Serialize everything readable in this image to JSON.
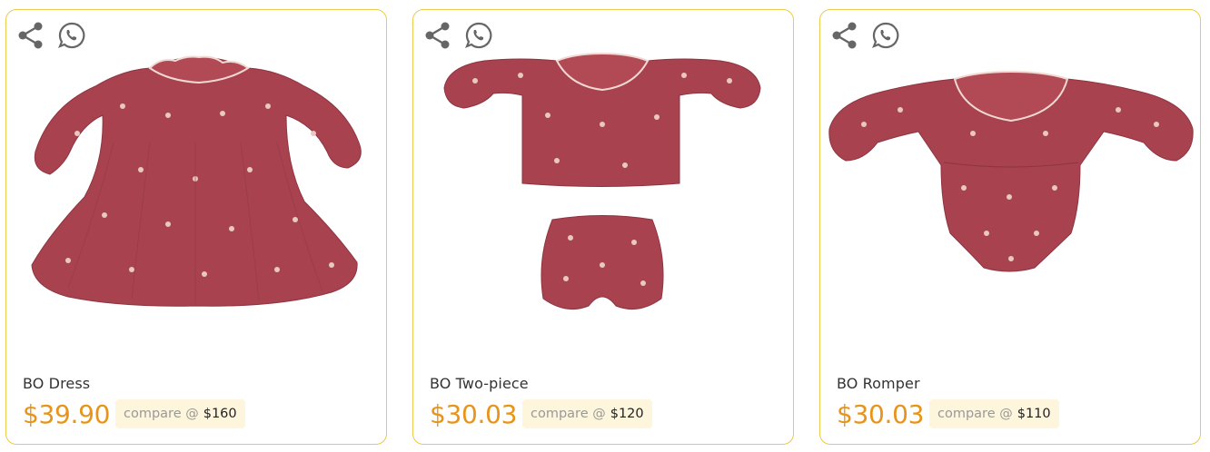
{
  "products": [
    {
      "name": "BO Dress",
      "price": "$39.90",
      "compare_label": "compare @",
      "compare_price": "$160",
      "image": "dress"
    },
    {
      "name": "BO Two-piece",
      "price": "$30.03",
      "compare_label": "compare @",
      "compare_price": "$120",
      "image": "two-piece"
    },
    {
      "name": "BO Romper",
      "price": "$30.03",
      "compare_label": "compare @",
      "compare_price": "$110",
      "image": "romper"
    }
  ],
  "icons": {
    "share": "share-icon",
    "whatsapp": "whatsapp-icon"
  },
  "colors": {
    "border": "#ecc94b",
    "price": "#e8941a",
    "compare_bg": "#fdf5dc",
    "fabric": "#a8424f"
  }
}
